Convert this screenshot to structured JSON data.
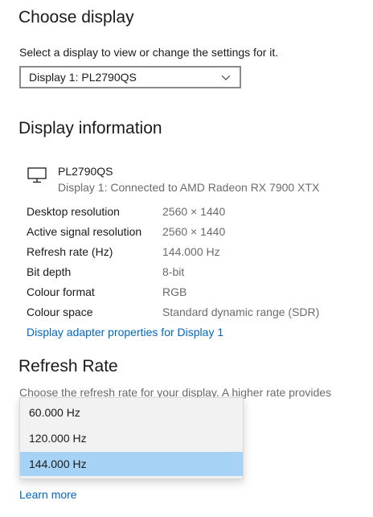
{
  "choose_display": {
    "heading": "Choose display",
    "instruction": "Select a display to view or change the settings for it.",
    "selected_display": "Display 1: PL2790QS"
  },
  "display_information": {
    "heading": "Display information",
    "monitor_name": "PL2790QS",
    "monitor_connection": "Display 1: Connected to AMD Radeon RX 7900 XTX",
    "rows": [
      {
        "label": "Desktop resolution",
        "value": "2560 × 1440"
      },
      {
        "label": "Active signal resolution",
        "value": "2560 × 1440"
      },
      {
        "label": "Refresh rate (Hz)",
        "value": "144.000 Hz"
      },
      {
        "label": "Bit depth",
        "value": "8-bit"
      },
      {
        "label": "Colour format",
        "value": "RGB"
      },
      {
        "label": "Colour space",
        "value": "Standard dynamic range (SDR)"
      }
    ],
    "adapter_link": "Display adapter properties for Display 1"
  },
  "refresh_rate": {
    "heading": "Refresh Rate",
    "description": "Choose the refresh rate for your display. A higher rate provides",
    "options": [
      "60.000 Hz",
      "120.000 Hz",
      "144.000 Hz"
    ],
    "selected_option": "144.000 Hz",
    "learn_more": "Learn more"
  },
  "colors": {
    "accent_link": "#0067c0",
    "selected_option_bg": "#a6d2f5"
  }
}
